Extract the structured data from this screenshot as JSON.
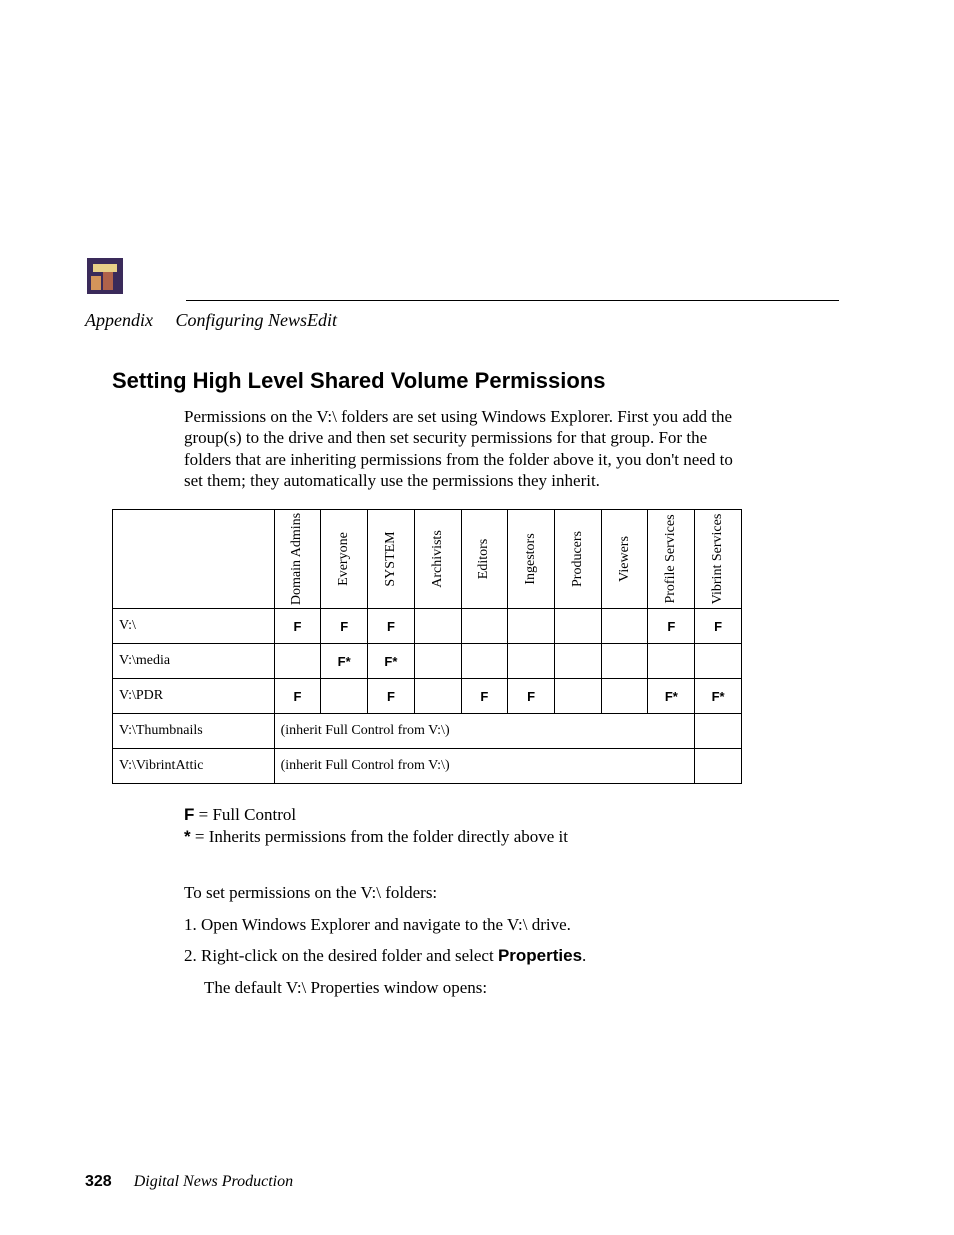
{
  "header": {
    "appendix_label": "Appendix",
    "chapter_title": "Configuring NewsEdit"
  },
  "section": {
    "title": "Setting High Level Shared Volume Permissions",
    "intro": "Permissions on the V:\\ folders are set using Windows Explorer. First you add the group(s) to the drive and then set security permissions for that group. For the folders that are inheriting permissions from the folder above it, you don't need to set them; they automatically use the permissions they inherit."
  },
  "table": {
    "columns": [
      "Domain Admins",
      "Everyone",
      "SYSTEM",
      "Archivists",
      "Editors",
      "Ingestors",
      "Producers",
      "Viewers",
      "Profile Services",
      "Vibrint Services"
    ],
    "rows": [
      {
        "label": "V:\\",
        "cells": [
          "F",
          "F",
          "F",
          "",
          "",
          "",
          "",
          "",
          "F",
          "F"
        ]
      },
      {
        "label": "V:\\media",
        "cells": [
          "",
          "F*",
          "F*",
          "",
          "",
          "",
          "",
          "",
          "",
          ""
        ]
      },
      {
        "label": "V:\\PDR",
        "cells": [
          "F",
          "",
          "F",
          "",
          "F",
          "F",
          "",
          "",
          "F*",
          "F*"
        ]
      },
      {
        "label": "V:\\Thumbnails",
        "inherit": "(inherit Full Control from V:\\)",
        "last": ""
      },
      {
        "label": "V:\\VibrintAttic",
        "inherit": "(inherit Full Control from V:\\)",
        "last": ""
      }
    ]
  },
  "legend": {
    "f_symbol": "F",
    "f_text": " = Full Control",
    "star_symbol": "*",
    "star_text": " = Inherits permissions from the folder directly above it"
  },
  "steps": {
    "intro": "To set permissions on the V:\\ folders:",
    "step1": "1. Open Windows Explorer and navigate to the V:\\ drive.",
    "step2_pre": "2. Right-click on the desired folder and select ",
    "step2_bold": "Properties",
    "step2_post": ".",
    "step2_result": "The default V:\\ Properties window opens:"
  },
  "footer": {
    "page_number": "328",
    "book_title": "Digital News Production"
  }
}
